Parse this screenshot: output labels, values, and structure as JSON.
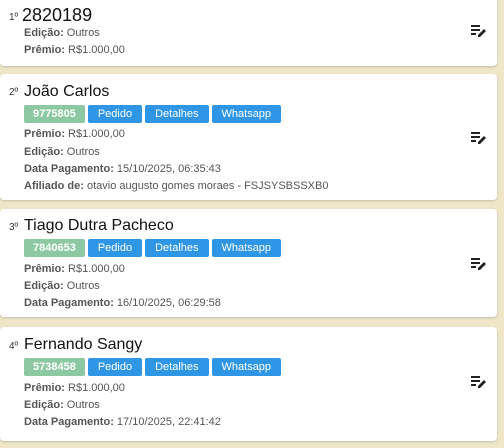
{
  "cards": [
    {
      "rank": "1º",
      "name": "2820189",
      "rows": [
        {
          "label": "Edição:",
          "value": "Outros"
        },
        {
          "label": "Prêmio:",
          "value": "R$1.000,00"
        }
      ]
    },
    {
      "rank": "2º",
      "name": "João Carlos",
      "badge": "9775805",
      "buttons": [
        "Pedido",
        "Detalhes",
        "Whatsapp"
      ],
      "rows": [
        {
          "label": "Prêmio:",
          "value": "R$1.000,00"
        },
        {
          "label": "Edição:",
          "value": "Outros"
        },
        {
          "label": "Data Pagamento:",
          "value": "15/10/2025, 06:35:43"
        },
        {
          "label": "Afiliado de:",
          "value": "otavio augusto gomes moraes - FSJSYSBSSXB0"
        }
      ]
    },
    {
      "rank": "3º",
      "name": "Tiago Dutra Pacheco",
      "badge": "7840653",
      "buttons": [
        "Pedido",
        "Detalhes",
        "Whatsapp"
      ],
      "rows": [
        {
          "label": "Prêmio:",
          "value": "R$1.000,00"
        },
        {
          "label": "Edição:",
          "value": "Outros"
        },
        {
          "label": "Data Pagamento:",
          "value": "16/10/2025, 06:29:58"
        }
      ]
    },
    {
      "rank": "4º",
      "name": "Fernando Sangy",
      "badge": "5738458",
      "buttons": [
        "Pedido",
        "Detalhes",
        "Whatsapp"
      ],
      "rows": [
        {
          "label": "Prêmio:",
          "value": "R$1.000,00"
        },
        {
          "label": "Edição:",
          "value": "Outros"
        },
        {
          "label": "Data Pagamento:",
          "value": "17/10/2025, 22:41:42"
        }
      ]
    }
  ],
  "icons": {
    "edit": "edit-list-icon"
  },
  "colors": {
    "badge": "#8cc9a2",
    "button": "#2f96e6",
    "background": "#efe6c8"
  }
}
